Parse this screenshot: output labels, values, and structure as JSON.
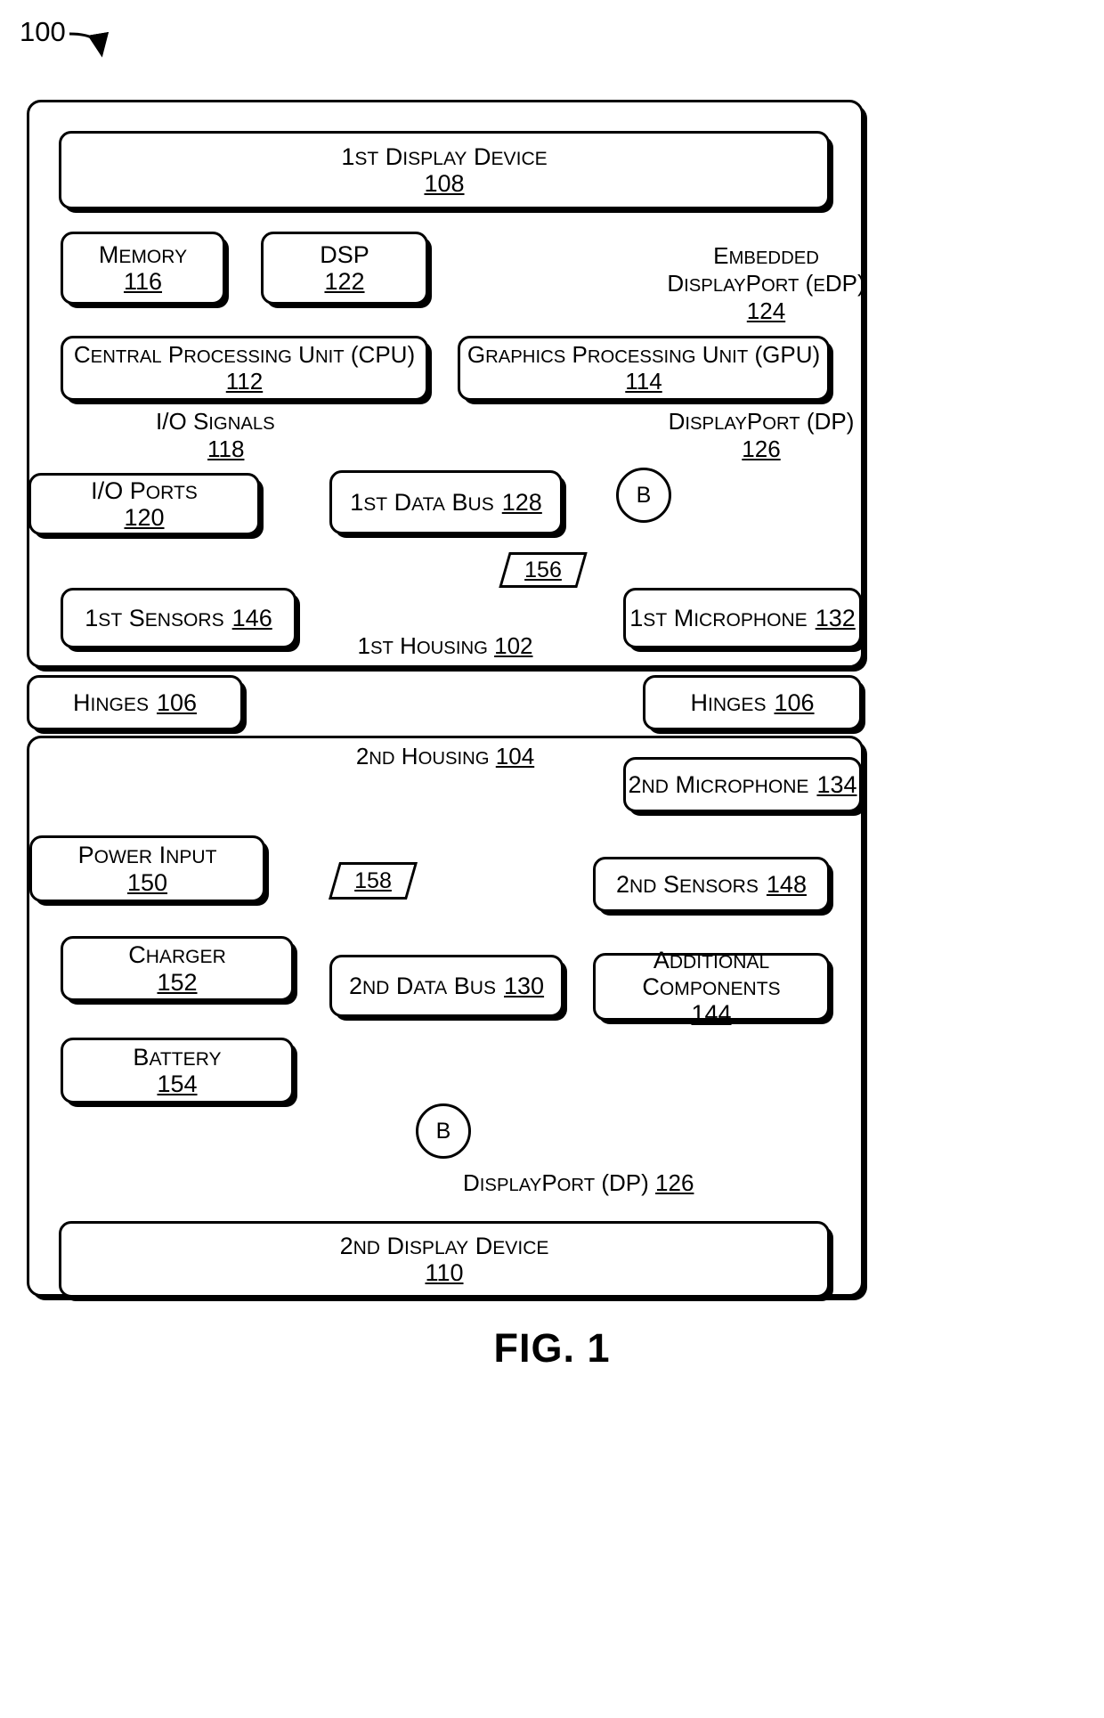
{
  "figure": {
    "number_tag": "100",
    "caption": "FIG. 1"
  },
  "housings": {
    "first": {
      "label": "1st Housing",
      "ref": "102"
    },
    "second": {
      "label": "2nd Housing",
      "ref": "104"
    }
  },
  "blocks": {
    "display1": {
      "label": "1st Display Device",
      "ref": "108"
    },
    "memory": {
      "label": "Memory",
      "ref": "116"
    },
    "dsp": {
      "label": "DSP",
      "ref": "122"
    },
    "cpu": {
      "label": "Central Processing Unit (CPU)",
      "ref": "112"
    },
    "gpu": {
      "label": "Graphics Processing Unit (GPU)",
      "ref": "114"
    },
    "ioports": {
      "label": "I/O Ports",
      "ref": "120"
    },
    "databus1": {
      "label": "1st Data Bus",
      "ref": "128"
    },
    "sensors1": {
      "label": "1st Sensors",
      "ref": "146"
    },
    "mic1": {
      "label": "1st Microphone",
      "ref": "132"
    },
    "hinges_left": {
      "label": "Hinges",
      "ref": "106"
    },
    "hinges_right": {
      "label": "Hinges",
      "ref": "106"
    },
    "mic2": {
      "label": "2nd Microphone",
      "ref": "134"
    },
    "power": {
      "label": "Power Input",
      "ref": "150"
    },
    "charger": {
      "label": "Charger",
      "ref": "152"
    },
    "battery": {
      "label": "Battery",
      "ref": "154"
    },
    "sensors2": {
      "label": "2nd Sensors",
      "ref": "148"
    },
    "databus2": {
      "label": "2nd Data Bus",
      "ref": "130"
    },
    "addcomp": {
      "label": "Additional Components",
      "ref": "144"
    },
    "display2": {
      "label": "2nd Display Device",
      "ref": "110"
    }
  },
  "connector_labels": {
    "edp": {
      "line1": "Embedded",
      "line2": "DisplayPort (eDP)",
      "ref": "124"
    },
    "dp_top": {
      "label": "DisplayPort (DP)",
      "ref": "126"
    },
    "dp_bottom": {
      "label": "DisplayPort (DP)",
      "ref": "126"
    },
    "io_signals": {
      "label": "I/O Signals",
      "ref": "118"
    }
  },
  "markers": {
    "parallelogram_156": "156",
    "parallelogram_158": "158",
    "offpage_b_top": "B",
    "offpage_b_bottom": "B"
  },
  "colors": {
    "ink": "#000000",
    "paper": "#ffffff"
  }
}
